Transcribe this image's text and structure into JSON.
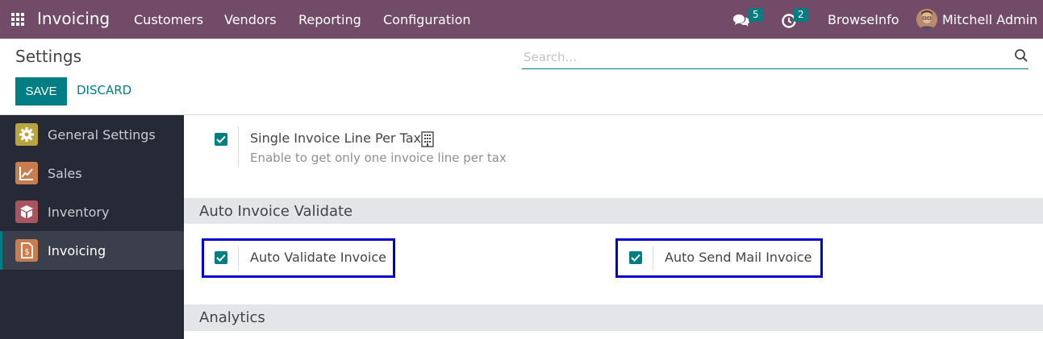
{
  "navbar": {
    "app_name": "Invoicing",
    "menu": [
      "Customers",
      "Vendors",
      "Reporting",
      "Configuration"
    ],
    "messages_badge": "5",
    "activities_badge": "2",
    "company": "BrowseInfo",
    "user": "Mitchell Admin",
    "bg_color": "#714b67",
    "icons": [
      "apps-grid-icon",
      "chat-icon",
      "clock-icon"
    ]
  },
  "control_panel": {
    "title": "Settings",
    "save_label": "SAVE",
    "discard_label": "DISCARD",
    "search_placeholder": "Search...",
    "accent": "#017e84"
  },
  "sidebar": {
    "items": [
      {
        "label": "General Settings",
        "icon": "gear-icon",
        "active": false
      },
      {
        "label": "Sales",
        "icon": "chart-icon",
        "active": false
      },
      {
        "label": "Inventory",
        "icon": "box-icon",
        "active": false
      },
      {
        "label": "Invoicing",
        "icon": "invoice-icon",
        "active": true
      }
    ]
  },
  "content": {
    "single_invoice": {
      "label": "Single Invoice Line Per Tax",
      "description": "Enable to get only one invoice line per tax",
      "checked": true
    },
    "auto_section": {
      "title": "Auto Invoice Validate",
      "auto_validate_label": "Auto Validate Invoice",
      "auto_validate_checked": true,
      "auto_send_label": "Auto Send Mail Invoice",
      "auto_send_checked": true
    },
    "analytics_section": {
      "title": "Analytics"
    }
  }
}
